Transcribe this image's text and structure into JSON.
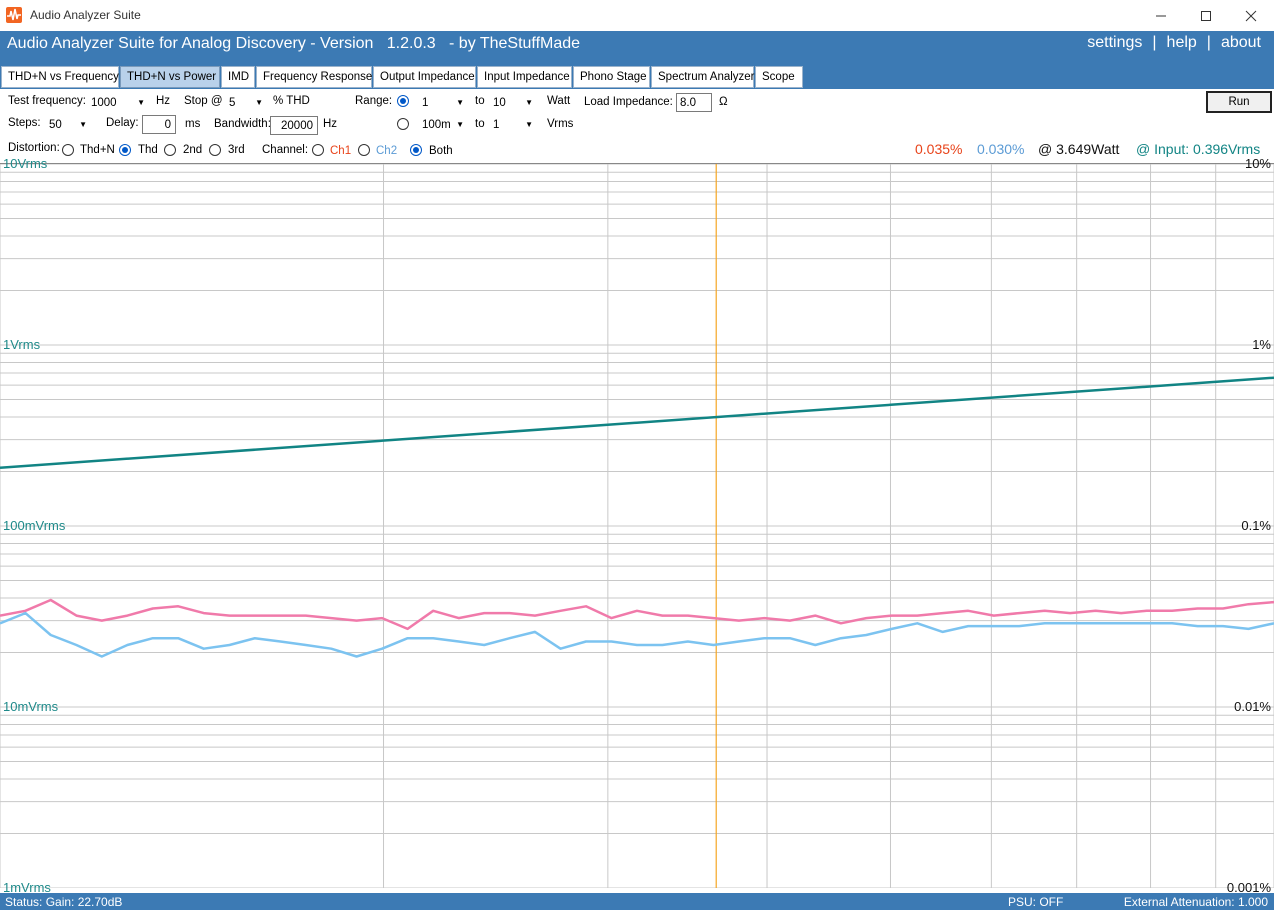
{
  "window": {
    "title": "Audio Analyzer Suite",
    "icon": "waveform-app-icon"
  },
  "header": {
    "title": "Audio Analyzer Suite for Analog Discovery - Version   1.2.0.3   - by TheStuffMade",
    "links": {
      "settings": "settings",
      "help": "help",
      "about": "about",
      "separator": "|"
    }
  },
  "tabs": [
    {
      "label": "THD+N vs Frequency",
      "active": false
    },
    {
      "label": "THD+N vs Power",
      "active": true
    },
    {
      "label": "IMD",
      "active": false
    },
    {
      "label": "Frequency Response",
      "active": false
    },
    {
      "label": "Output Impedance",
      "active": false
    },
    {
      "label": "Input Impedance",
      "active": false
    },
    {
      "label": "Phono Stage",
      "active": false
    },
    {
      "label": "Spectrum Analyzer",
      "active": false
    },
    {
      "label": "Scope",
      "active": false
    }
  ],
  "controls": {
    "test_frequency_label": "Test frequency:",
    "test_frequency_value": "1000",
    "hz": "Hz",
    "stop_label": "Stop @",
    "stop_value": "5",
    "pct_thd": "% THD",
    "steps_label": "Steps:",
    "steps_value": "50",
    "delay_label": "Delay:",
    "delay_value": "0",
    "ms": "ms",
    "bandwidth_label": "Bandwidth:",
    "bandwidth_value": "20000",
    "range_label": "Range:",
    "range_watt_from": "1",
    "to": "to",
    "range_watt_to": "10",
    "watt": "Watt",
    "range_vrms_from": "100m",
    "range_vrms_to": "1",
    "vrms": "Vrms",
    "load_impedance_label": "Load Impedance:",
    "load_impedance_value": "8.0",
    "ohm": "Ω",
    "run_label": "Run",
    "distortion_label": "Distortion:",
    "distortion_options": [
      "Thd+N",
      "Thd",
      "2nd",
      "3rd"
    ],
    "distortion_selected": "Thd",
    "channel_label": "Channel:",
    "channel_options": [
      "Ch1",
      "Ch2",
      "Both"
    ],
    "channel_selected": "Both"
  },
  "readouts": {
    "ch1_thd": "0.035%",
    "ch2_thd": "0.030%",
    "power": "@ 3.649Watt",
    "input": "@ Input: 0.396Vrms"
  },
  "colors": {
    "accent": "#3c7ab4",
    "ch1": "#e8431a",
    "ch2": "#5b9bd5",
    "input_line": "#118484",
    "ch1_trace": "#f07aaa",
    "ch2_trace": "#7cc3f0",
    "cursor": "#f5a623",
    "grid": "#c8c8c8"
  },
  "chart_data": {
    "type": "line",
    "x_scale": "log",
    "x_unit": "Watt",
    "xlim": [
      1,
      10
    ],
    "left_axis": {
      "scale": "log",
      "ticks": [
        "10Vrms",
        "1Vrms",
        "100mVrms",
        "10mVrms",
        "1mVrms"
      ]
    },
    "right_axis": {
      "scale": "log",
      "ticks": [
        "10%",
        "1%",
        "0.1%",
        "0.01%",
        "0.001%"
      ],
      "ylim_percent": [
        0.001,
        10
      ]
    },
    "cursor_x_watt": 3.649,
    "series": [
      {
        "key": "input_vrms",
        "axis": "left",
        "x": [
          1,
          10
        ],
        "values": [
          0.21,
          0.66
        ]
      },
      {
        "key": "ch1_thd_percent",
        "axis": "right",
        "x": [
          1.0,
          1.047,
          1.096,
          1.148,
          1.202,
          1.259,
          1.318,
          1.38,
          1.445,
          1.514,
          1.585,
          1.66,
          1.738,
          1.82,
          1.905,
          1.995,
          2.089,
          2.188,
          2.291,
          2.399,
          2.512,
          2.63,
          2.754,
          2.884,
          3.02,
          3.162,
          3.311,
          3.467,
          3.631,
          3.802,
          3.981,
          4.169,
          4.365,
          4.571,
          4.786,
          5.012,
          5.248,
          5.495,
          5.754,
          6.026,
          6.31,
          6.607,
          6.918,
          7.244,
          7.586,
          7.943,
          8.318,
          8.71,
          9.12,
          9.55,
          10.0
        ],
        "values": [
          0.032,
          0.034,
          0.039,
          0.032,
          0.03,
          0.032,
          0.035,
          0.036,
          0.033,
          0.032,
          0.032,
          0.032,
          0.032,
          0.031,
          0.03,
          0.031,
          0.027,
          0.034,
          0.031,
          0.033,
          0.033,
          0.032,
          0.034,
          0.036,
          0.031,
          0.034,
          0.032,
          0.032,
          0.031,
          0.03,
          0.031,
          0.03,
          0.032,
          0.029,
          0.031,
          0.032,
          0.032,
          0.033,
          0.034,
          0.032,
          0.033,
          0.034,
          0.033,
          0.034,
          0.033,
          0.034,
          0.034,
          0.035,
          0.035,
          0.037,
          0.038
        ]
      },
      {
        "key": "ch2_thd_percent",
        "axis": "right",
        "x": [
          1.0,
          1.047,
          1.096,
          1.148,
          1.202,
          1.259,
          1.318,
          1.38,
          1.445,
          1.514,
          1.585,
          1.66,
          1.738,
          1.82,
          1.905,
          1.995,
          2.089,
          2.188,
          2.291,
          2.399,
          2.512,
          2.63,
          2.754,
          2.884,
          3.02,
          3.162,
          3.311,
          3.467,
          3.631,
          3.802,
          3.981,
          4.169,
          4.365,
          4.571,
          4.786,
          5.012,
          5.248,
          5.495,
          5.754,
          6.026,
          6.31,
          6.607,
          6.918,
          7.244,
          7.586,
          7.943,
          8.318,
          8.71,
          9.12,
          9.55,
          10.0
        ],
        "values": [
          0.029,
          0.033,
          0.025,
          0.022,
          0.019,
          0.022,
          0.024,
          0.024,
          0.021,
          0.022,
          0.024,
          0.023,
          0.022,
          0.021,
          0.019,
          0.021,
          0.024,
          0.024,
          0.023,
          0.022,
          0.024,
          0.026,
          0.021,
          0.023,
          0.023,
          0.022,
          0.022,
          0.023,
          0.022,
          0.023,
          0.024,
          0.024,
          0.022,
          0.024,
          0.025,
          0.027,
          0.029,
          0.026,
          0.028,
          0.028,
          0.028,
          0.029,
          0.029,
          0.029,
          0.029,
          0.029,
          0.029,
          0.028,
          0.028,
          0.027,
          0.029
        ]
      }
    ]
  },
  "status": {
    "left": "Status: Gain: 22.70dB",
    "psu": "PSU: OFF",
    "attenuation": "External Attenuation: 1.000"
  }
}
